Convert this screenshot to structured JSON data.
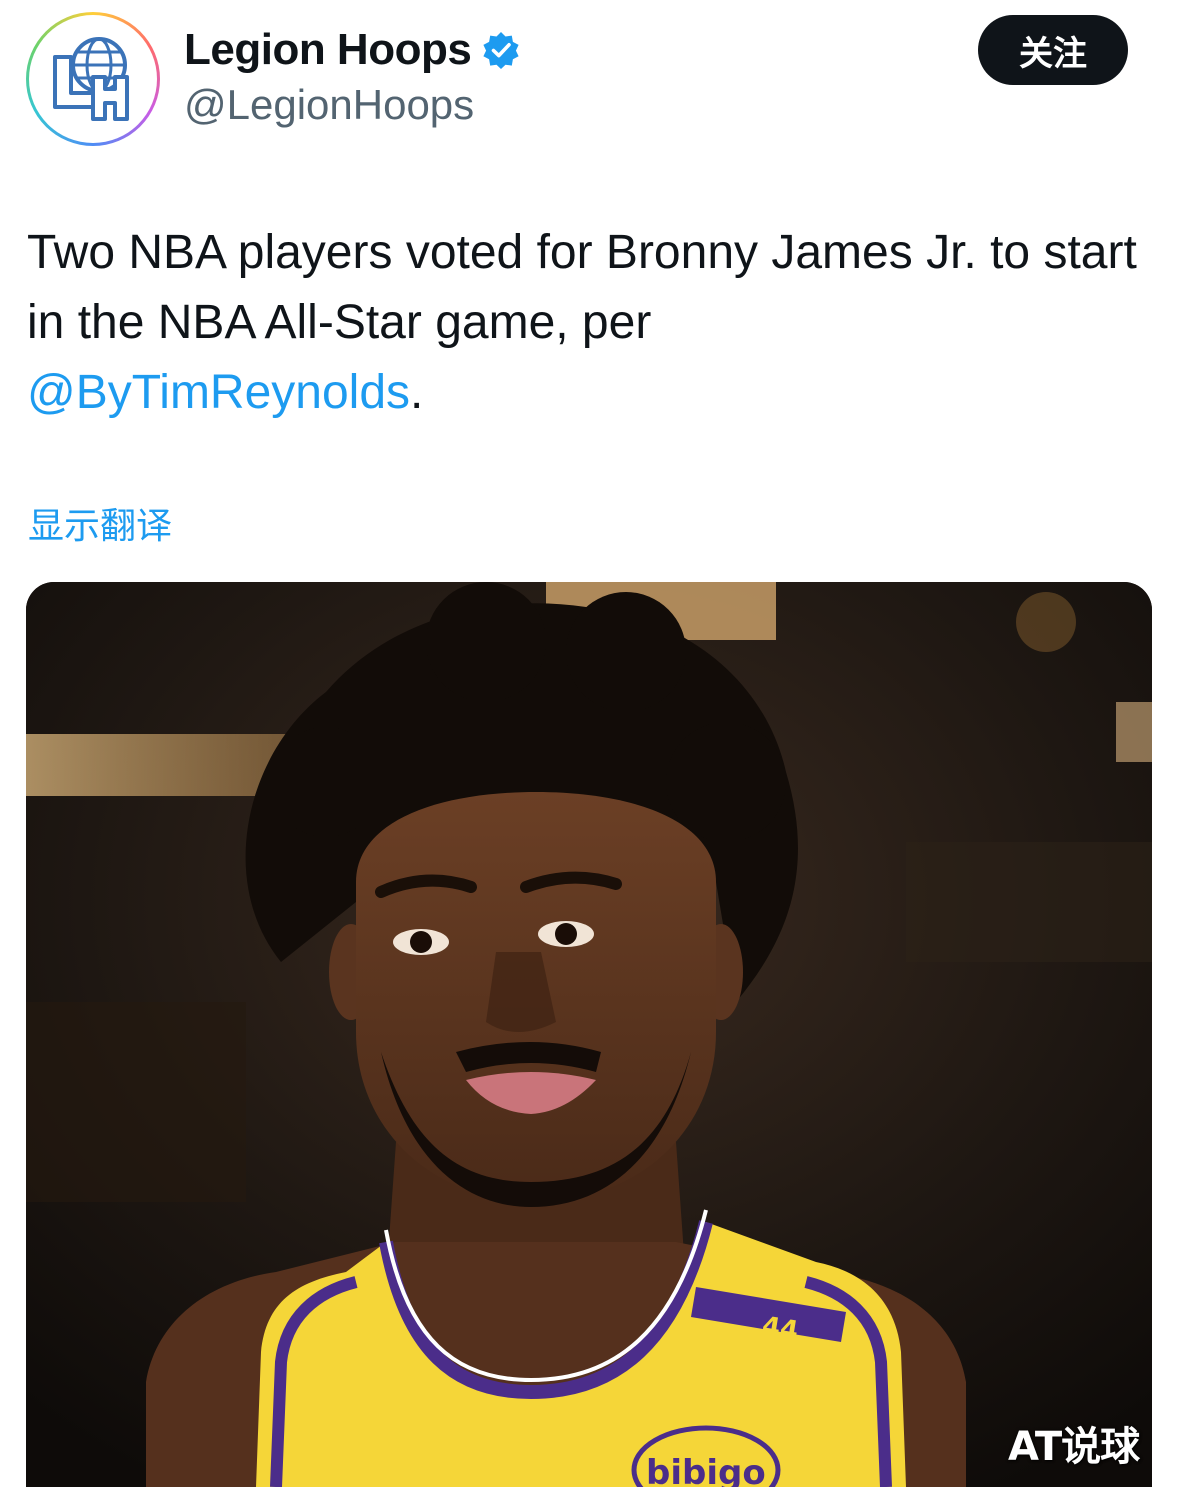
{
  "account": {
    "display_name": "Legion Hoops",
    "handle": "@LegionHoops",
    "avatar_monogram": "LH",
    "verified": true,
    "verified_color": "#1d9bf0"
  },
  "follow_button": {
    "label": "关注"
  },
  "tweet": {
    "text_before_mention": "Two NBA players voted for Bronny James Jr. to start in the NBA All-Star game, per ",
    "mention": "@ByTimReynolds",
    "text_after_mention": "."
  },
  "translate_link": "显示翻译",
  "media": {
    "jersey_number": "44",
    "jersey_sponsor": "bibigo",
    "jersey_color": "#f5d638",
    "trim_color": "#4b2d8a"
  },
  "watermark": "AT说球",
  "colors": {
    "link": "#1d9bf0",
    "text": "#0f1419",
    "secondary_text": "#536471"
  }
}
